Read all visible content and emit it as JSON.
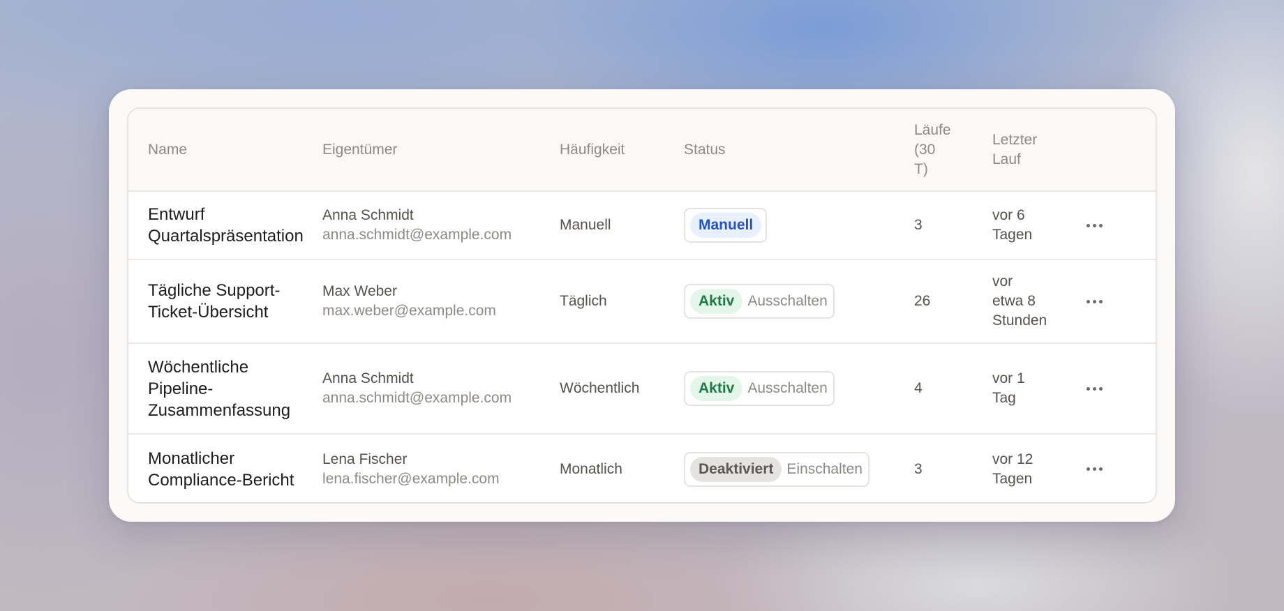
{
  "table": {
    "headers": {
      "name": "Name",
      "owner": "Eigentümer",
      "frequency": "Häufigkeit",
      "status": "Status",
      "runs_line1": "Läufe",
      "runs_line2": "(30",
      "runs_line3": "T)",
      "last_run_line1": "Letzter",
      "last_run_line2": "Lauf"
    },
    "rows": [
      {
        "name_line1": "Entwurf",
        "name_line2": "Quartalspräsentation",
        "name_line3": "",
        "owner_name": "Anna Schmidt",
        "owner_email": "anna.schmidt@example.com",
        "frequency": "Manuell",
        "status_label": "Manuell",
        "status_action": "",
        "runs": "3",
        "last_run_line1": "vor 6",
        "last_run_line2": "Tagen",
        "last_run_line3": ""
      },
      {
        "name_line1": "Tägliche Support-",
        "name_line2": "Ticket-Übersicht",
        "name_line3": "",
        "owner_name": "Max Weber",
        "owner_email": "max.weber@example.com",
        "frequency": "Täglich",
        "status_label": "Aktiv",
        "status_action": "Ausschalten",
        "runs": "26",
        "last_run_line1": "vor",
        "last_run_line2": "etwa 8",
        "last_run_line3": "Stunden"
      },
      {
        "name_line1": "Wöchentliche",
        "name_line2": "Pipeline-",
        "name_line3": "Zusammenfassung",
        "owner_name": "Anna Schmidt",
        "owner_email": "anna.schmidt@example.com",
        "frequency": "Wöchentlich",
        "status_label": "Aktiv",
        "status_action": "Ausschalten",
        "runs": "4",
        "last_run_line1": "vor 1",
        "last_run_line2": "Tag",
        "last_run_line3": ""
      },
      {
        "name_line1": "Monatlicher",
        "name_line2": "Compliance-Bericht",
        "name_line3": "",
        "owner_name": "Lena Fischer",
        "owner_email": "lena.fischer@example.com",
        "frequency": "Monatlich",
        "status_label": "Deaktiviert",
        "status_action": "Einschalten",
        "runs": "3",
        "last_run_line1": "vor 12",
        "last_run_line2": "Tagen",
        "last_run_line3": ""
      }
    ]
  },
  "icons": {
    "row_menu": "more-horizontal-icon"
  },
  "colors": {
    "manual_badge_bg": "#e8f0fd",
    "manual_badge_text": "#2451c4",
    "active_badge_bg": "#e4f5ea",
    "active_badge_text": "#1f7a45",
    "disabled_badge_bg": "#e5e3df",
    "disabled_badge_text": "#5b5853"
  }
}
